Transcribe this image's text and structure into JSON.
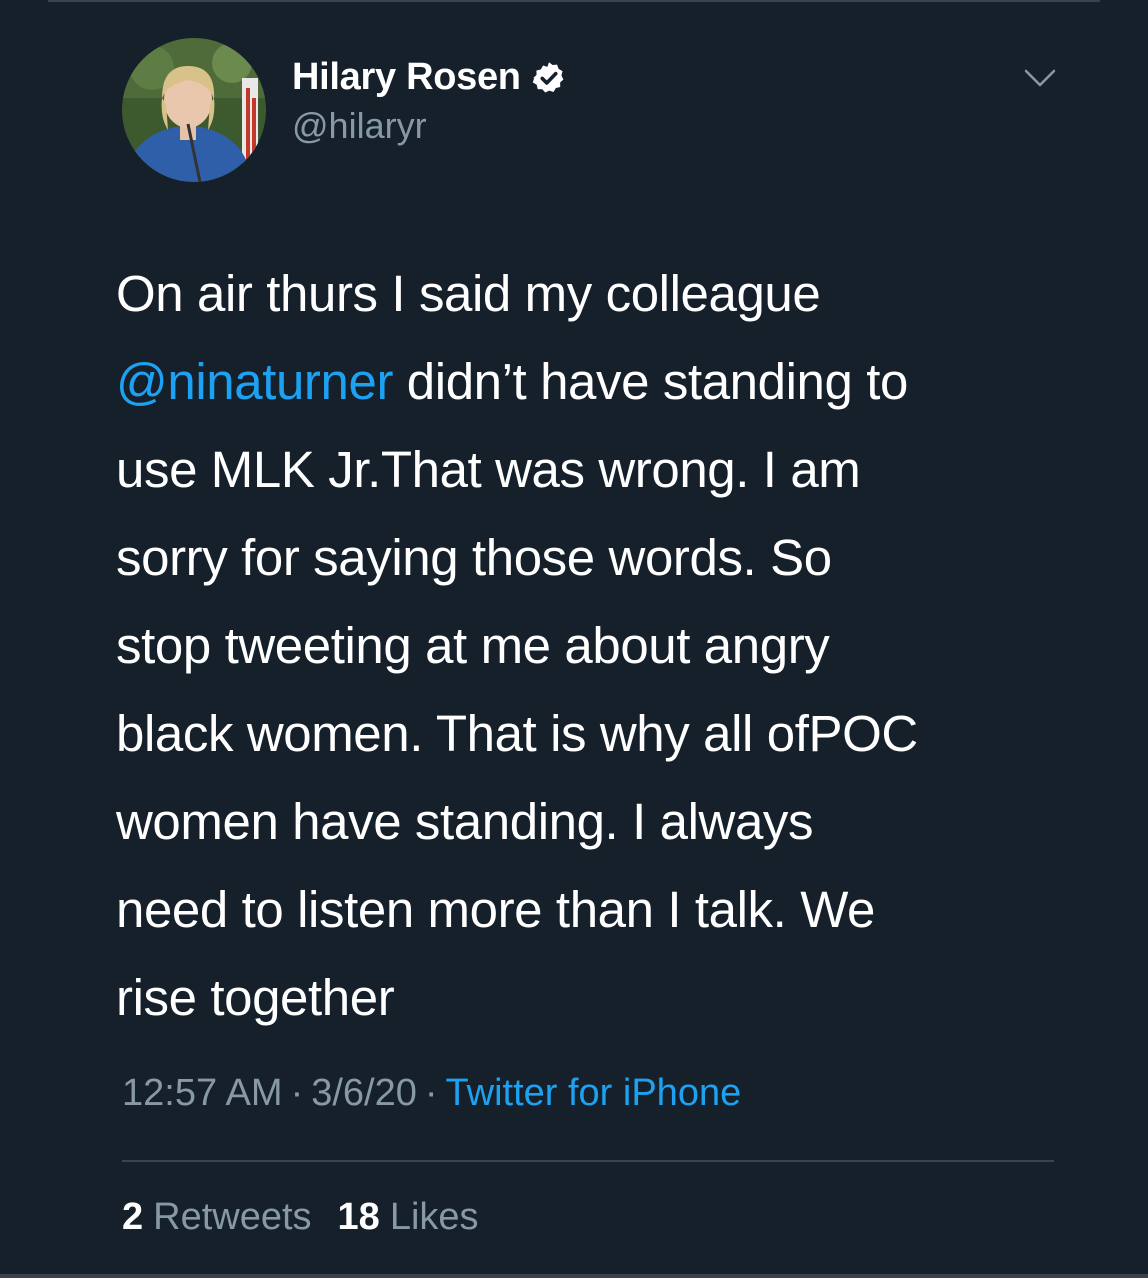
{
  "user": {
    "display_name": "Hilary Rosen",
    "handle": "@hilaryr",
    "avatar_icon": "profile-photo",
    "verified_icon": "verified-badge-icon"
  },
  "tweet": {
    "lines": [
      {
        "text": "On air thurs I said my colleague"
      },
      {
        "mention": "@ninaturner",
        "text": " didn’t have standing to"
      },
      {
        "text": "use MLK Jr.That was wrong. I am"
      },
      {
        "text": "sorry for saying those words. So"
      },
      {
        "text": "stop tweeting at me about angry"
      },
      {
        "text": "black women. That is why all ofPOC"
      },
      {
        "text": "women have standing. I always"
      },
      {
        "text": "need to listen more than I talk. We"
      },
      {
        "text": "rise together"
      }
    ]
  },
  "meta": {
    "time": "12:57 AM",
    "separator": "·",
    "date": "3/6/20",
    "source": "Twitter for iPhone"
  },
  "stats": {
    "retweets_count": "2",
    "retweets_label": "Retweets",
    "likes_count": "18",
    "likes_label": "Likes"
  },
  "colors": {
    "background": "#15202b",
    "text": "#ffffff",
    "secondary": "#8899a6",
    "accent": "#1da1f2",
    "divider": "#38444d"
  },
  "menu": {
    "icon": "chevron-down-icon"
  }
}
